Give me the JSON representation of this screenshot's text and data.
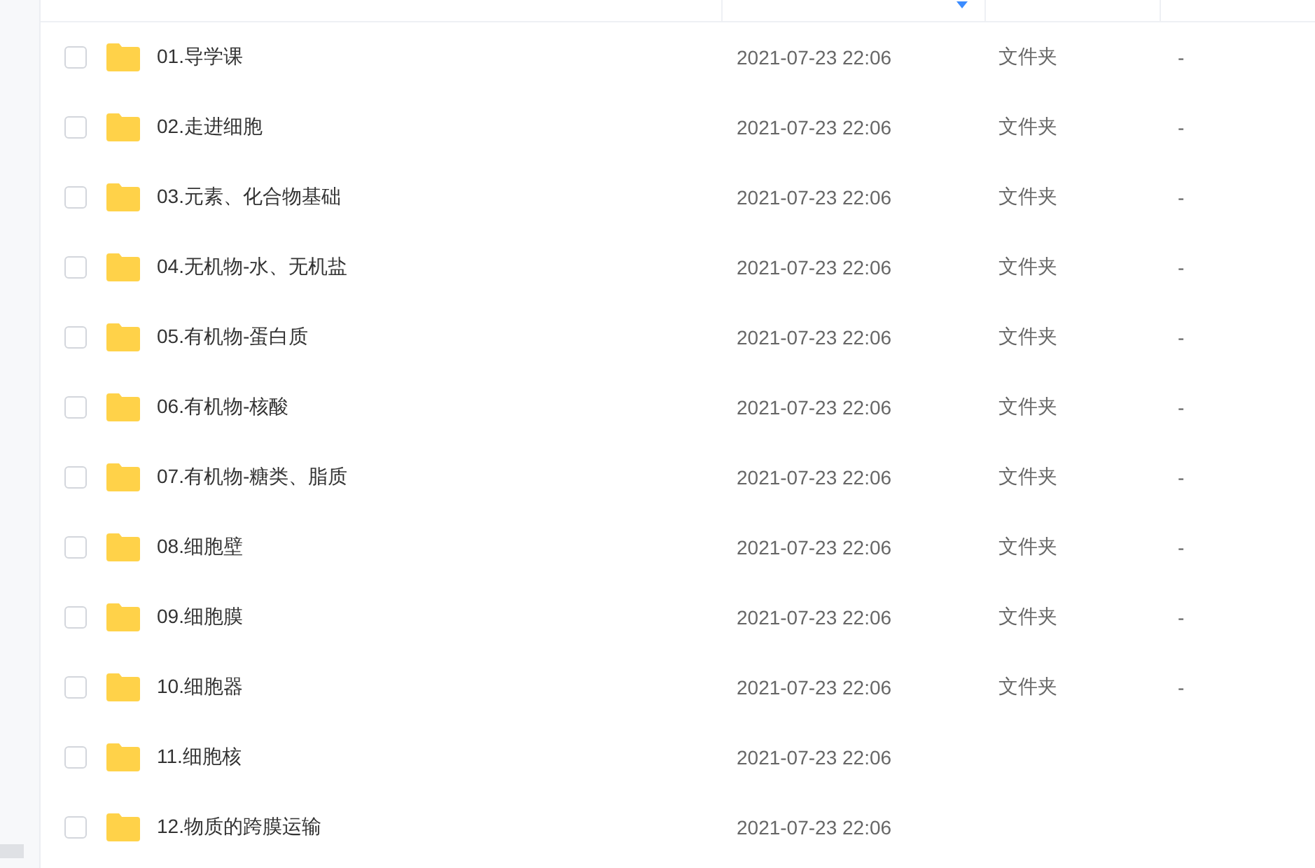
{
  "files": [
    {
      "name": "01.导学课",
      "modified": "2021-07-23 22:06",
      "type": "文件夹",
      "size": "-",
      "selected": false
    },
    {
      "name": "02.走进细胞",
      "modified": "2021-07-23 22:06",
      "type": "文件夹",
      "size": "-",
      "selected": false
    },
    {
      "name": "03.元素、化合物基础",
      "modified": "2021-07-23 22:06",
      "type": "文件夹",
      "size": "-",
      "selected": false
    },
    {
      "name": "04.无机物-水、无机盐",
      "modified": "2021-07-23 22:06",
      "type": "文件夹",
      "size": "-",
      "selected": false
    },
    {
      "name": "05.有机物-蛋白质",
      "modified": "2021-07-23 22:06",
      "type": "文件夹",
      "size": "-",
      "selected": false
    },
    {
      "name": "06.有机物-核酸",
      "modified": "2021-07-23 22:06",
      "type": "文件夹",
      "size": "-",
      "selected": false
    },
    {
      "name": "07.有机物-糖类、脂质",
      "modified": "2021-07-23 22:06",
      "type": "文件夹",
      "size": "-",
      "selected": false
    },
    {
      "name": "08.细胞壁",
      "modified": "2021-07-23 22:06",
      "type": "文件夹",
      "size": "-",
      "selected": false
    },
    {
      "name": "09.细胞膜",
      "modified": "2021-07-23 22:06",
      "type": "文件夹",
      "size": "-",
      "selected": false
    },
    {
      "name": "10.细胞器",
      "modified": "2021-07-23 22:06",
      "type": "文件夹",
      "size": "-",
      "selected": false
    },
    {
      "name": "11.细胞核",
      "modified": "2021-07-23 22:06",
      "selected": false
    },
    {
      "name": "12.物质的跨膜运输",
      "modified": "2021-07-23 22:06",
      "selected": false
    }
  ]
}
